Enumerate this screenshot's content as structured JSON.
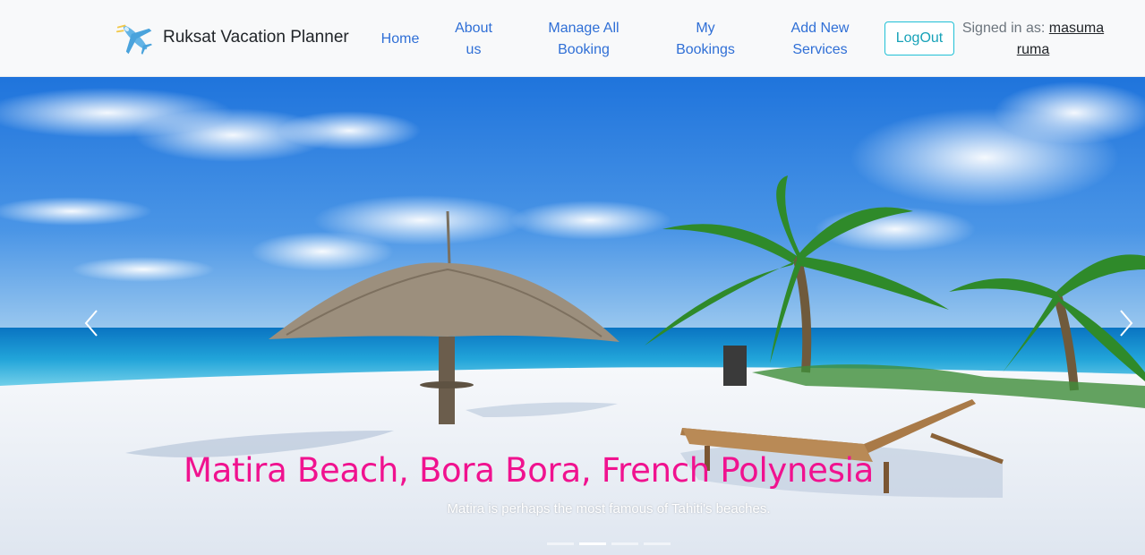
{
  "brand": {
    "name": "Ruksat Vacation Planner",
    "logo_icon": "airplane-icon"
  },
  "nav": {
    "home": "Home",
    "about": "About us",
    "manage_all": "Manage All Booking",
    "my_bookings": "My Bookings",
    "add_service": "Add New Services",
    "logout": "LogOut",
    "signed_in_label": "Signed in as:",
    "user_name": "masuma ruma"
  },
  "carousel": {
    "title": "Matira Beach, Bora Bora, French Polynesia",
    "subtitle": "Matira is perhaps the most famous of Tahiti's beaches.",
    "prev_icon": "chevron-left-icon",
    "next_icon": "chevron-right-icon",
    "slide_count": 4,
    "active_index": 1
  },
  "colors": {
    "nav_link": "#2f6fd6",
    "logout_border": "#20c0d6",
    "caption_title": "#f0128f",
    "navbar_bg": "#f8f9fa"
  }
}
